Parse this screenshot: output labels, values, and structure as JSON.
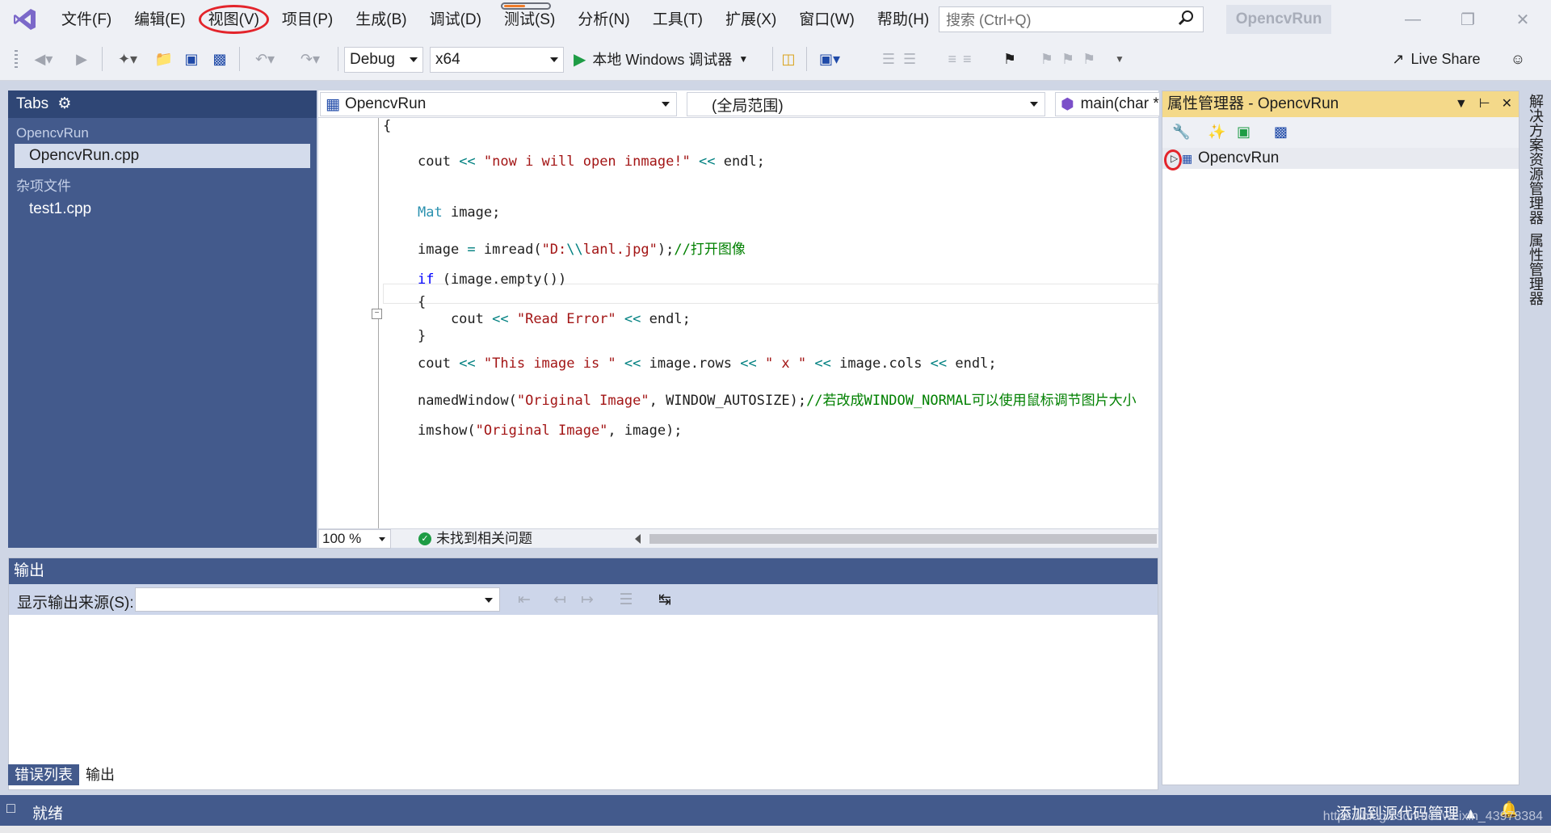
{
  "menubar": {
    "items": [
      "文件(F)",
      "编辑(E)",
      "视图(V)",
      "项目(P)",
      "生成(B)",
      "调试(D)",
      "测试(S)",
      "分析(N)",
      "工具(T)",
      "扩展(X)",
      "窗口(W)",
      "帮助(H)"
    ],
    "search_placeholder": "搜索 (Ctrl+Q)",
    "app_name": "OpencvRun"
  },
  "toolbar": {
    "config": "Debug",
    "platform": "x64",
    "debugger": "本地 Windows 调试器",
    "live_share": "Live Share"
  },
  "tabs_panel": {
    "title": "Tabs",
    "groups": [
      {
        "name": "OpencvRun",
        "files": [
          "OpencvRun.cpp"
        ]
      },
      {
        "name": "杂项文件",
        "files": [
          "test1.cpp"
        ]
      }
    ],
    "active_file": "OpencvRun.cpp"
  },
  "editor": {
    "nav_project": "OpencvRun",
    "nav_scope": "(全局范围)",
    "nav_member": "main(char *",
    "zoom": "100 %",
    "issues": "未找到相关问题",
    "lines": [
      [
        {
          "t": "{",
          "c": "pl"
        }
      ],
      [
        {
          "t": "cout ",
          "c": "pl"
        },
        {
          "t": "<<",
          "c": "op"
        },
        {
          "t": " \"now i will open inmage!\" ",
          "c": "st"
        },
        {
          "t": "<<",
          "c": "op"
        },
        {
          "t": " endl;",
          "c": "pl"
        }
      ],
      [
        {
          "t": "Mat",
          "c": "ty"
        },
        {
          "t": " image;",
          "c": "pl"
        }
      ],
      [
        {
          "t": "image ",
          "c": "pl"
        },
        {
          "t": "=",
          "c": "op"
        },
        {
          "t": " imread(",
          "c": "pl"
        },
        {
          "t": "\"D:",
          "c": "st"
        },
        {
          "t": "\\\\",
          "c": "op"
        },
        {
          "t": "lanl.jpg\"",
          "c": "st"
        },
        {
          "t": ");",
          "c": "pl"
        },
        {
          "t": "//打开图像",
          "c": "cm"
        }
      ],
      [
        {
          "t": "if",
          "c": "kw"
        },
        {
          "t": " (image.empty())",
          "c": "pl"
        }
      ],
      [
        {
          "t": "{",
          "c": "pl"
        }
      ],
      [
        {
          "t": "    cout ",
          "c": "pl"
        },
        {
          "t": "<<",
          "c": "op"
        },
        {
          "t": " \"Read Error\" ",
          "c": "st"
        },
        {
          "t": "<<",
          "c": "op"
        },
        {
          "t": " endl;",
          "c": "pl"
        }
      ],
      [
        {
          "t": "}",
          "c": "pl"
        }
      ],
      [
        {
          "t": "cout ",
          "c": "pl"
        },
        {
          "t": "<<",
          "c": "op"
        },
        {
          "t": " \"This image is \" ",
          "c": "st"
        },
        {
          "t": "<<",
          "c": "op"
        },
        {
          "t": " image.rows ",
          "c": "pl"
        },
        {
          "t": "<<",
          "c": "op"
        },
        {
          "t": " \" x \" ",
          "c": "st"
        },
        {
          "t": "<<",
          "c": "op"
        },
        {
          "t": " image.cols ",
          "c": "pl"
        },
        {
          "t": "<<",
          "c": "op"
        },
        {
          "t": " endl;",
          "c": "pl"
        }
      ],
      [
        {
          "t": "namedWindow(",
          "c": "pl"
        },
        {
          "t": "\"Original Image\"",
          "c": "st"
        },
        {
          "t": ", WINDOW_AUTOSIZE);",
          "c": "pl"
        },
        {
          "t": "//若改成WINDOW_NORMAL可以使用鼠标调节图片大小",
          "c": "cm"
        }
      ],
      [
        {
          "t": "imshow(",
          "c": "pl"
        },
        {
          "t": "\"Original Image\"",
          "c": "st"
        },
        {
          "t": ", image);",
          "c": "pl"
        }
      ]
    ]
  },
  "output": {
    "title": "输出",
    "source_label": "显示输出来源(S):",
    "source_value": ""
  },
  "bottom_tabs": [
    "错误列表",
    "输出"
  ],
  "property_manager": {
    "title": "属性管理器 - OpencvRun",
    "tree_item": "OpencvRun"
  },
  "side_tabs": [
    "解决方案资源管理器",
    "属性管理器"
  ],
  "statusbar": {
    "ready": "就绪",
    "source_control": "添加到源代码管理",
    "watermark": "https://blog.csdn.net/weixin_43978384"
  },
  "colors": {
    "accent_red": "#e3242b",
    "panel_blue": "#435a8c",
    "prop_header": "#f4d98a"
  }
}
